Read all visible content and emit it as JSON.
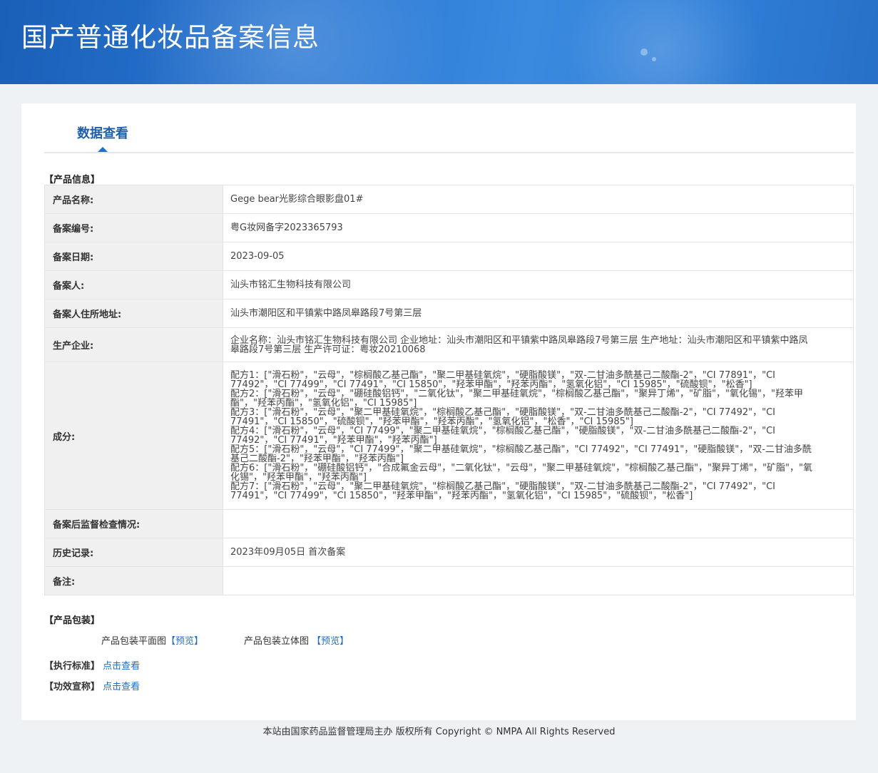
{
  "header": {
    "title": "国产普通化妆品备案信息"
  },
  "tabs": [
    {
      "label": "数据查看"
    }
  ],
  "product_info": {
    "section_title": "【产品信息】",
    "rows": [
      {
        "key": "产品名称:",
        "value": "Gege bear光影综合眼影盘01#"
      },
      {
        "key": "备案编号:",
        "value": "粤G妆网备字2023365793"
      },
      {
        "key": "备案日期:",
        "value": "2023-09-05"
      },
      {
        "key": "备案人:",
        "value": "汕头市铭汇生物科技有限公司"
      },
      {
        "key": "备案人住所地址:",
        "value": "汕头市潮阳区和平镇紫中路凤皋路段7号第三层"
      },
      {
        "key": "生产企业:",
        "value": "企业名称：汕头市铭汇生物科技有限公司 企业地址：汕头市潮阳区和平镇紫中路凤皋路段7号第三层 生产地址：汕头市潮阳区和平镇紫中路凤皋路段7号第三层 生产许可证：粤妆20210068"
      },
      {
        "key": "成分:",
        "lines": [
          "配方1：[\"滑石粉\"，\"云母\"，\"棕榈酸乙基己酯\"，\"聚二甲基硅氧烷\"，\"硬脂酸镁\"，\"双-二甘油多酰基己二酸酯-2\"，\"CI 77891\"，\"CI 77492\"，\"CI 77499\"，\"CI 77491\"，\"CI 15850\"，\"羟苯甲酯\"，\"羟苯丙酯\"，\"氢氧化铝\"，\"CI 15985\"，\"硫酸钡\"，\"松香\"]",
          "配方2：[\"滑石粉\"，\"云母\"，\"硼硅酸铝钙\"，\"二氧化钛\"，\"聚二甲基硅氧烷\"，\"棕榈酸乙基己酯\"，\"聚异丁烯\"，\"矿脂\"，\"氧化锡\"，\"羟苯甲酯\"，\"羟苯丙酯\"，\"氢氧化铝\"，\"CI 15985\"]",
          "配方3：[\"滑石粉\"，\"云母\"，\"聚二甲基硅氧烷\"，\"棕榈酸乙基己酯\"，\"硬脂酸镁\"，\"双-二甘油多酰基己二酸酯-2\"，\"CI 77492\"，\"CI 77491\"，\"CI 15850\"，\"硫酸钡\"，\"羟苯甲酯\"，\"羟苯丙酯\"，\"氢氧化铝\"，\"松香\"，\"CI 15985\"]",
          "配方4：[\"滑石粉\"，\"云母\"，\"CI 77499\"，\"聚二甲基硅氧烷\"，\"棕榈酸乙基己酯\"，\"硬脂酸镁\"，\"双-二甘油多酰基己二酸酯-2\"，\"CI 77492\"，\"CI 77491\"，\"羟苯甲酯\"，\"羟苯丙酯\"]",
          "配方5：[\"滑石粉\"，\"云母\"，\"CI 77499\"，\"聚二甲基硅氧烷\"，\"棕榈酸乙基己酯\"，\"CI 77492\"，\"CI 77491\"，\"硬脂酸镁\"，\"双-二甘油多酰基己二酸酯-2\"，\"羟苯甲酯\"，\"羟苯丙酯\"]",
          "配方6：[\"滑石粉\"，\"硼硅酸铝钙\"，\"合成氟金云母\"，\"二氧化钛\"，\"云母\"，\"聚二甲基硅氧烷\"，\"棕榈酸乙基己酯\"，\"聚异丁烯\"，\"矿脂\"，\"氧化锡\"，\"羟苯甲酯\"，\"羟苯丙酯\"]",
          "配方7：[\"滑石粉\"，\"云母\"，\"聚二甲基硅氧烷\"，\"棕榈酸乙基己酯\"，\"硬脂酸镁\"，\"双-二甘油多酰基己二酸酯-2\"，\"CI 77492\"，\"CI 77491\"，\"CI 77499\"，\"CI 15850\"，\"羟苯甲酯\"，\"羟苯丙酯\"，\"氢氧化铝\"，\"CI 15985\"，\"硫酸钡\"，\"松香\"]"
        ]
      },
      {
        "key": "备案后监督检查情况:",
        "value": ""
      },
      {
        "key": "历史记录:",
        "value": "2023年09月05日 首次备案"
      },
      {
        "key": "备注:",
        "value": ""
      }
    ]
  },
  "packaging": {
    "section_title": "【产品包装】",
    "flat_label": "产品包装平面图",
    "flat_preview": "【预览】",
    "three_d_label": "产品包装立体图",
    "three_d_preview": "【预览】"
  },
  "standard": {
    "label": "【执行标准】",
    "link": "点击查看"
  },
  "efficacy": {
    "label": "【功效宣称】",
    "link": "点击查看"
  },
  "footer": {
    "text": "本站由国家药品监督管理局主办 版权所有 Copyright © NMPA All Rights Reserved"
  }
}
